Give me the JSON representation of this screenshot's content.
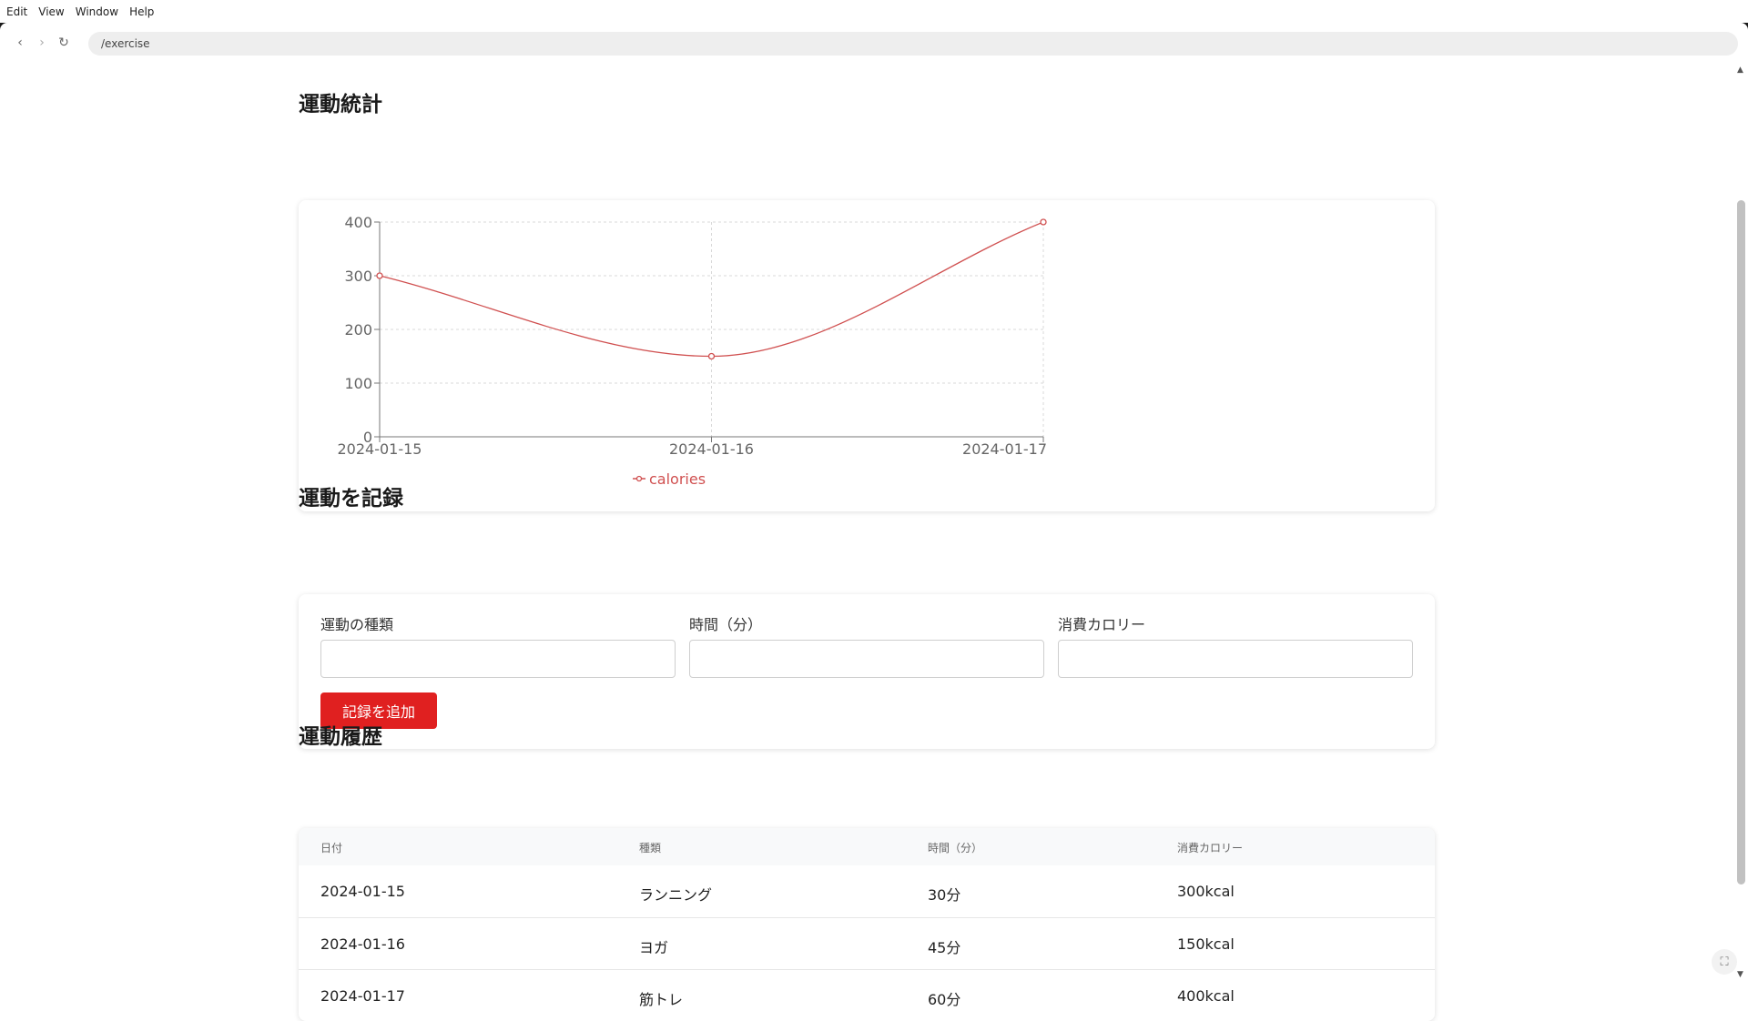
{
  "menu": [
    "Edit",
    "View",
    "Window",
    "Help"
  ],
  "url": "/exercise",
  "sections": {
    "stats_title": "運動統計",
    "record_title": "運動を記録",
    "history_title": "運動履歴"
  },
  "form": {
    "type_label": "運動の種類",
    "duration_label": "時間（分）",
    "calories_label": "消費カロリー",
    "type_value": "",
    "duration_value": "",
    "calories_value": "",
    "submit_label": "記録を追加"
  },
  "table": {
    "headers": [
      "日付",
      "種類",
      "時間（分）",
      "消費カロリー"
    ],
    "rows": [
      [
        "2024-01-15",
        "ランニング",
        "30分",
        "300kcal"
      ],
      [
        "2024-01-16",
        "ヨガ",
        "45分",
        "150kcal"
      ],
      [
        "2024-01-17",
        "筋トレ",
        "60分",
        "400kcal"
      ]
    ]
  },
  "chart_data": {
    "type": "line",
    "x": [
      "2024-01-15",
      "2024-01-16",
      "2024-01-17"
    ],
    "series": [
      {
        "name": "calories",
        "values": [
          300,
          150,
          400
        ]
      }
    ],
    "yticks": [
      0,
      100,
      200,
      300,
      400
    ],
    "ylim": [
      0,
      400
    ],
    "grid": true,
    "legend": "bottom",
    "curve": "smooth",
    "color": "#d05050"
  },
  "colors": {
    "accent": "#e02020",
    "line": "#d05050"
  },
  "icons": [
    "back-icon",
    "forward-icon",
    "reload-icon",
    "scroll-up-icon",
    "scroll-down-icon",
    "expand-icon"
  ]
}
